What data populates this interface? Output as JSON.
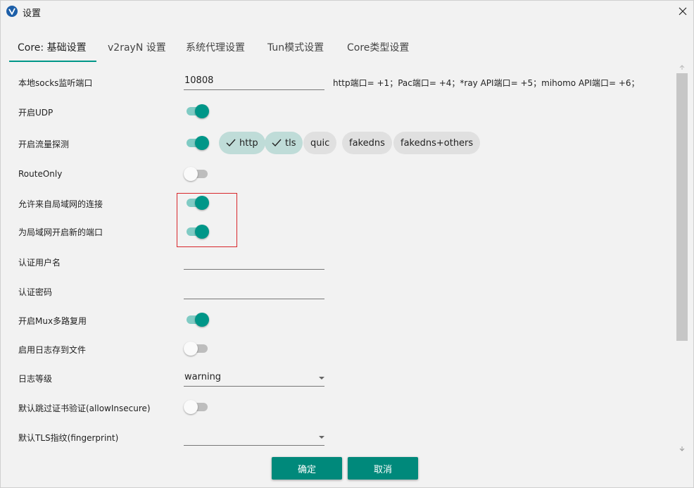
{
  "window": {
    "title": "设置",
    "icon": "v2rayn-logo-icon"
  },
  "tabs": [
    {
      "label": "Core: 基础设置",
      "active": true
    },
    {
      "label": "v2rayN 设置",
      "active": false
    },
    {
      "label": "系统代理设置",
      "active": false
    },
    {
      "label": "Tun模式设置",
      "active": false
    },
    {
      "label": "Core类型设置",
      "active": false
    }
  ],
  "settings": {
    "socks_port": {
      "label": "本地socks监听端口",
      "value": "10808",
      "hint": "http端口= +1；Pac端口= +4；*ray API端口= +5；mihomo API端口= +6；"
    },
    "enable_udp": {
      "label": "开启UDP",
      "on": true
    },
    "sniffing": {
      "label": "开启流量探测",
      "on": true,
      "chips": [
        {
          "label": "http",
          "checked": true
        },
        {
          "label": "tls",
          "checked": true
        },
        {
          "label": "quic",
          "checked": false
        },
        {
          "label": "fakedns",
          "checked": false
        },
        {
          "label": "fakedns+others",
          "checked": false
        }
      ]
    },
    "route_only": {
      "label": "RouteOnly",
      "on": false
    },
    "allow_lan": {
      "label": "允许来自局域网的连接",
      "on": true
    },
    "new_lan_port": {
      "label": "为局域网开启新的端口",
      "on": true
    },
    "auth_user": {
      "label": "认证用户名",
      "value": ""
    },
    "auth_pass": {
      "label": "认证密码",
      "value": ""
    },
    "mux": {
      "label": "开启Mux多路复用",
      "on": true
    },
    "log_to_file": {
      "label": "启用日志存到文件",
      "on": false
    },
    "log_level": {
      "label": "日志等级",
      "value": "warning"
    },
    "allow_insecure": {
      "label": "默认跳过证书验证(allowInsecure)",
      "on": false
    },
    "fingerprint": {
      "label": "默认TLS指纹(fingerprint)",
      "value": ""
    }
  },
  "buttons": {
    "ok": "确定",
    "cancel": "取消"
  },
  "colors": {
    "accent": "#009688",
    "accent_light": "#80cbc4",
    "button": "#00897b",
    "highlight": "#d8262a"
  }
}
